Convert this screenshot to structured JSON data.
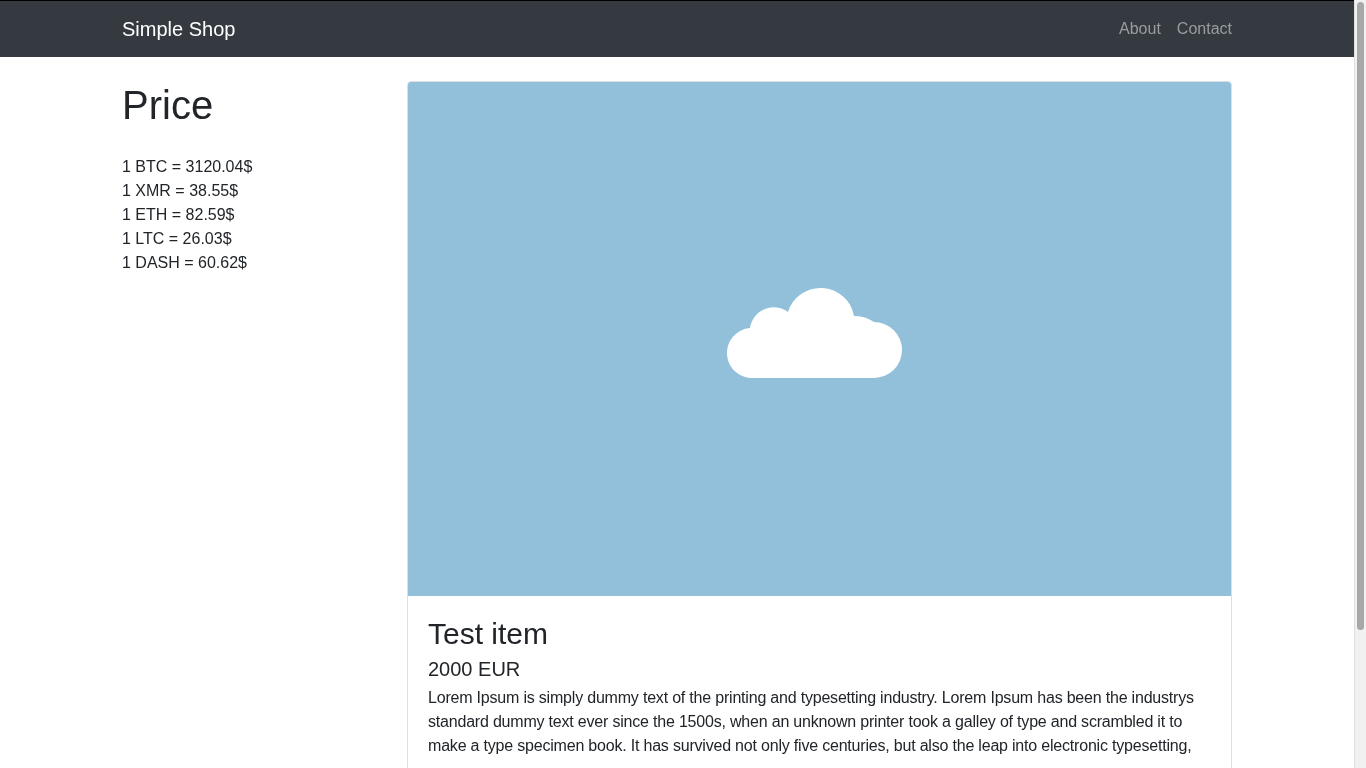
{
  "navbar": {
    "brand": "Simple Shop",
    "links": [
      {
        "label": "About"
      },
      {
        "label": "Contact"
      }
    ]
  },
  "sidebar": {
    "title": "Price",
    "rates": [
      "1 BTC = 3120.04$",
      "1 XMR = 38.55$",
      "1 ETH = 82.59$",
      "1 LTC = 26.03$",
      "1 DASH = 60.62$"
    ]
  },
  "item": {
    "title": "Test item",
    "price": "2000 EUR",
    "description": "Lorem Ipsum is simply dummy text of the printing and typesetting industry. Lorem Ipsum has been the industrys standard dummy text ever since the 1500s, when an unknown printer took a galley of type and scrambled it to make a type specimen book. It has survived not only five centuries, but also the leap into electronic typesetting,"
  }
}
